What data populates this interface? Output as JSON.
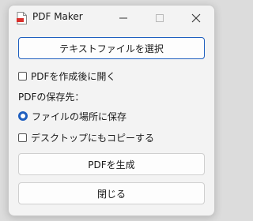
{
  "window": {
    "title": "PDF Maker"
  },
  "buttons": {
    "select_text_file": "テキストファイルを選択",
    "generate_pdf": "PDFを生成",
    "close": "閉じる"
  },
  "options": {
    "open_after_create_label": "PDFを作成後に開く",
    "open_after_create_checked": false,
    "save_location_label": "PDFの保存先：",
    "save_location_options": [
      "ファイルの場所に保存"
    ],
    "save_location_selected": "ファイルの場所に保存",
    "copy_to_desktop_label": "デスクトップにもコピーする",
    "copy_to_desktop_checked": false
  },
  "colors": {
    "accent": "#1f5fbf",
    "pdf_icon_red": "#d9302c"
  },
  "icons": {
    "app": "pdf-file-icon",
    "minimize": "minimize-icon",
    "maximize": "maximize-icon",
    "close": "close-icon"
  }
}
